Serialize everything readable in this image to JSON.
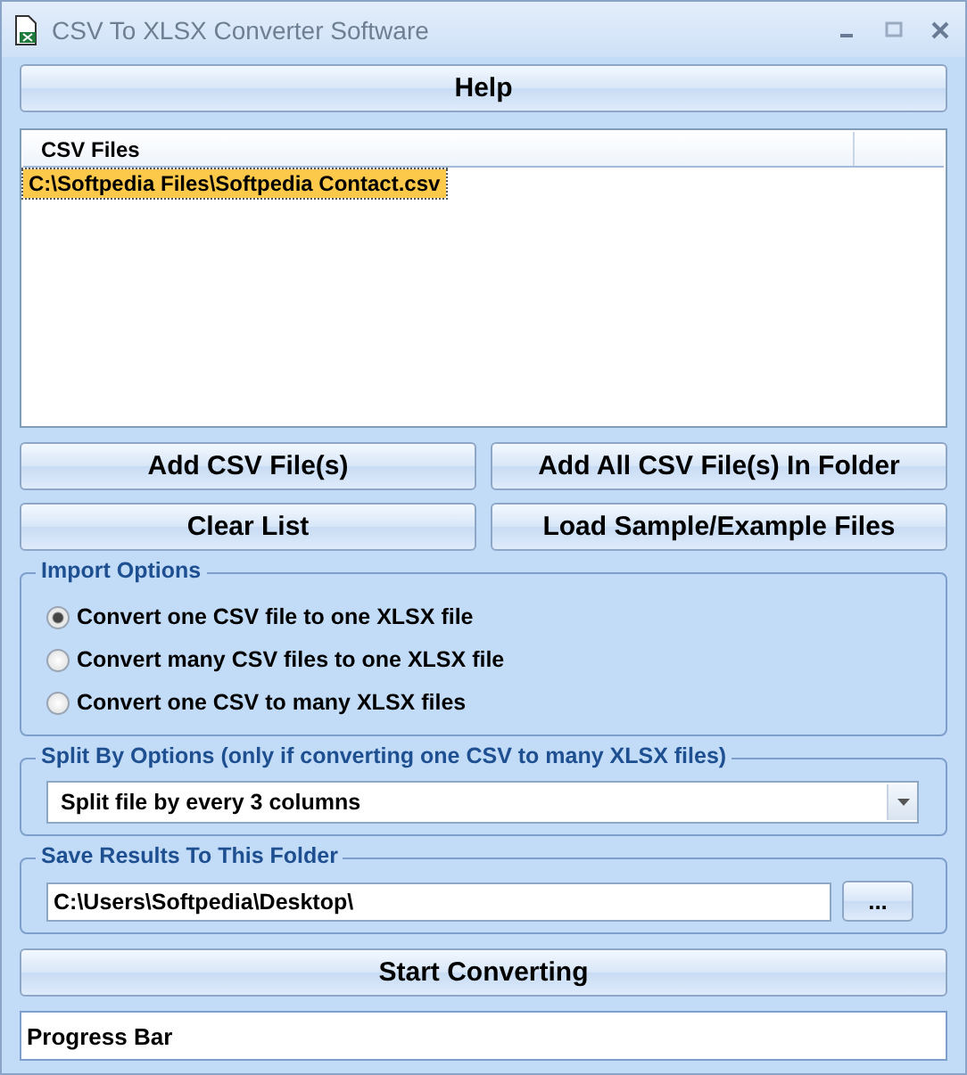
{
  "window": {
    "title": "CSV To XLSX Converter Software"
  },
  "help_button": "Help",
  "file_list": {
    "columns": [
      "CSV Files"
    ],
    "rows": [
      {
        "path": "C:\\Softpedia Files\\Softpedia Contact.csv",
        "selected": true
      }
    ]
  },
  "buttons": [
    {
      "label": "Add CSV File(s)"
    },
    {
      "label": "Add All CSV File(s) In Folder"
    },
    {
      "label": "Clear List"
    },
    {
      "label": "Load Sample/Example Files"
    }
  ],
  "import_options": {
    "title": "Import Options",
    "options": [
      {
        "label": "Convert one CSV file to one XLSX file",
        "selected": true
      },
      {
        "label": "Convert many CSV files to one XLSX file",
        "selected": false
      },
      {
        "label": "Convert one CSV to many XLSX files",
        "selected": false
      }
    ]
  },
  "split_options": {
    "title": "Split By Options (only if converting one CSV to many XLSX files)",
    "value": "Split file by every 3 columns"
  },
  "save_folder": {
    "title": "Save Results To This Folder",
    "value": "C:\\Users\\Softpedia\\Desktop\\",
    "browse": "..."
  },
  "start_button": "Start Converting",
  "progress_bar": {
    "text": "Progress Bar"
  }
}
